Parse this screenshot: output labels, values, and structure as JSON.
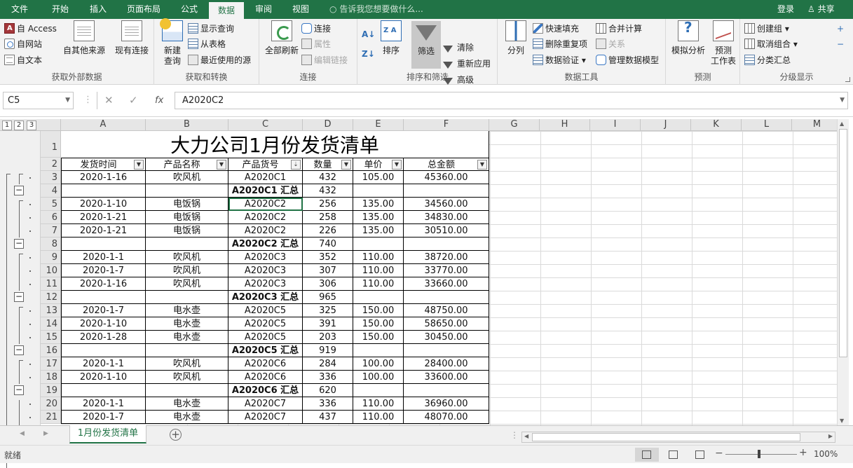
{
  "ribbon_tabs": [
    "文件",
    "开始",
    "插入",
    "页面布局",
    "公式",
    "数据",
    "审阅",
    "视图"
  ],
  "active_tab": "数据",
  "tell_me": "告诉我您想要做什么...",
  "account": {
    "login": "登录",
    "share": "共享"
  },
  "groups": {
    "get_external": {
      "label": "获取外部数据",
      "access": "自 Access",
      "web": "自网站",
      "text": "自文本",
      "other": "自其他来源",
      "existing": "现有连接"
    },
    "get_transform": {
      "label": "获取和转换",
      "new_query": "新建",
      "new_query_sub": "查询",
      "show_queries": "显示查询",
      "from_table": "从表格",
      "recent": "最近使用的源"
    },
    "connections": {
      "label": "连接",
      "refresh_all": "全部刷新",
      "connections": "连接",
      "properties": "属性",
      "edit_links": "编辑链接"
    },
    "sort_filter": {
      "label": "排序和筛选",
      "sort": "排序",
      "filter": "筛选",
      "clear": "清除",
      "reapply": "重新应用",
      "advanced": "高级"
    },
    "data_tools": {
      "label": "数据工具",
      "text_to_columns": "分列",
      "flash_fill": "快速填充",
      "remove_dup": "删除重复项",
      "validation": "数据验证",
      "consolidate": "合并计算",
      "relations": "关系",
      "data_model": "管理数据模型"
    },
    "forecast": {
      "label": "预测",
      "what_if": "模拟分析",
      "forecast_sheet": "预测",
      "forecast_sheet_sub": "工作表"
    },
    "outline": {
      "label": "分级显示",
      "group": "创建组",
      "ungroup": "取消组合",
      "subtotal": "分类汇总"
    }
  },
  "name_box": "C5",
  "formula": "A2020C2",
  "fx": "fx",
  "outline_levels": [
    "1",
    "2",
    "3"
  ],
  "columns": [
    "A",
    "B",
    "C",
    "D",
    "E",
    "F",
    "G",
    "H",
    "I",
    "J",
    "K",
    "L",
    "M"
  ],
  "rows": [
    "1",
    "2",
    "3",
    "4",
    "5",
    "6",
    "7",
    "8",
    "9",
    "10",
    "11",
    "12",
    "13",
    "14",
    "15",
    "16",
    "17",
    "18",
    "19",
    "20",
    "21"
  ],
  "sheet_title": "大力公司1月份发货清单",
  "table_headers": [
    "发货时间",
    "产品名称",
    "产品货号",
    "数量",
    "单价",
    "总金额"
  ],
  "table_rows": [
    [
      "2020-1-16",
      "吹风机",
      "A2020C1",
      "432",
      "105.00",
      "45360.00"
    ],
    [
      "",
      "",
      "A2020C1 汇总",
      "432",
      "",
      ""
    ],
    [
      "2020-1-10",
      "电饭锅",
      "A2020C2",
      "256",
      "135.00",
      "34560.00"
    ],
    [
      "2020-1-21",
      "电饭锅",
      "A2020C2",
      "258",
      "135.00",
      "34830.00"
    ],
    [
      "2020-1-21",
      "电饭锅",
      "A2020C2",
      "226",
      "135.00",
      "30510.00"
    ],
    [
      "",
      "",
      "A2020C2 汇总",
      "740",
      "",
      ""
    ],
    [
      "2020-1-1",
      "吹风机",
      "A2020C3",
      "352",
      "110.00",
      "38720.00"
    ],
    [
      "2020-1-7",
      "吹风机",
      "A2020C3",
      "307",
      "110.00",
      "33770.00"
    ],
    [
      "2020-1-16",
      "吹风机",
      "A2020C3",
      "306",
      "110.00",
      "33660.00"
    ],
    [
      "",
      "",
      "A2020C3 汇总",
      "965",
      "",
      ""
    ],
    [
      "2020-1-7",
      "电水壶",
      "A2020C5",
      "325",
      "150.00",
      "48750.00"
    ],
    [
      "2020-1-10",
      "电水壶",
      "A2020C5",
      "391",
      "150.00",
      "58650.00"
    ],
    [
      "2020-1-28",
      "电水壶",
      "A2020C5",
      "203",
      "150.00",
      "30450.00"
    ],
    [
      "",
      "",
      "A2020C5 汇总",
      "919",
      "",
      ""
    ],
    [
      "2020-1-1",
      "吹风机",
      "A2020C6",
      "284",
      "100.00",
      "28400.00"
    ],
    [
      "2020-1-10",
      "吹风机",
      "A2020C6",
      "336",
      "100.00",
      "33600.00"
    ],
    [
      "",
      "",
      "A2020C6 汇总",
      "620",
      "",
      ""
    ],
    [
      "2020-1-1",
      "电水壶",
      "A2020C7",
      "336",
      "110.00",
      "36960.00"
    ],
    [
      "2020-1-7",
      "电水壶",
      "A2020C7",
      "437",
      "110.00",
      "48070.00"
    ]
  ],
  "sheet_tab": "1月份发货清单",
  "status": "就绪",
  "zoom": "100%",
  "colors": {
    "excel_green": "#217346"
  }
}
